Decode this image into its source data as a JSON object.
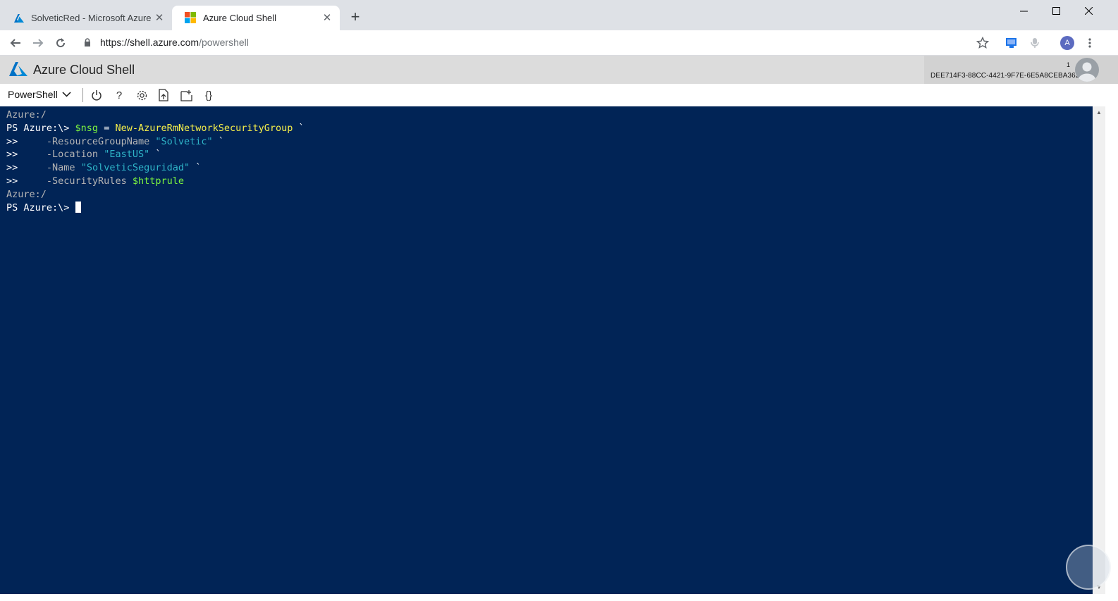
{
  "browser": {
    "tabs": [
      {
        "title": "SolveticRed - Microsoft Azure",
        "favicon": "azure-a-icon",
        "active": false
      },
      {
        "title": "Azure Cloud Shell",
        "favicon": "microsoft-logo-icon",
        "active": true
      }
    ],
    "close_glyph": "✕",
    "new_tab_glyph": "+",
    "url_host": "https://shell.azure.com",
    "url_path": "/powershell",
    "profile_initial": "A"
  },
  "azure_header": {
    "title": "Azure Cloud Shell",
    "account_id": "DEE714F3-88CC-4421-9F7E-6E5A8CEBA362",
    "notification_count": "1"
  },
  "toolbar": {
    "shell": "PowerShell",
    "icons": [
      "power-icon",
      "help-icon",
      "settings-icon",
      "upload-download-icon",
      "web-preview-icon",
      "editor-braces-icon"
    ],
    "help_glyph": "?",
    "braces_glyph": "{}"
  },
  "terminal": {
    "line1": "Azure:/",
    "prompt": "PS Azure:\\> ",
    "var_nsg": "$nsg",
    "eq": " = ",
    "cmdlet": "New-AzureRmNetworkSecurityGroup",
    "backtick": " `",
    "cont": ">>",
    "indent": "     ",
    "p1_name": "-ResourceGroupName ",
    "p1_val": "\"Solvetic\"",
    "p2_name": "-Location ",
    "p2_val": "\"EastUS\"",
    "p3_name": "-Name ",
    "p3_val": "\"SolveticSeguridad\"",
    "p4_name": "-SecurityRules ",
    "p4_val": "$httprule",
    "line7": "Azure:/",
    "prompt2": "PS Azure:\\> "
  },
  "colors": {
    "terminal_bg": "#012456",
    "variable": "#7cf53f",
    "cmdlet": "#f7f14a",
    "string": "#2fb5c8"
  }
}
